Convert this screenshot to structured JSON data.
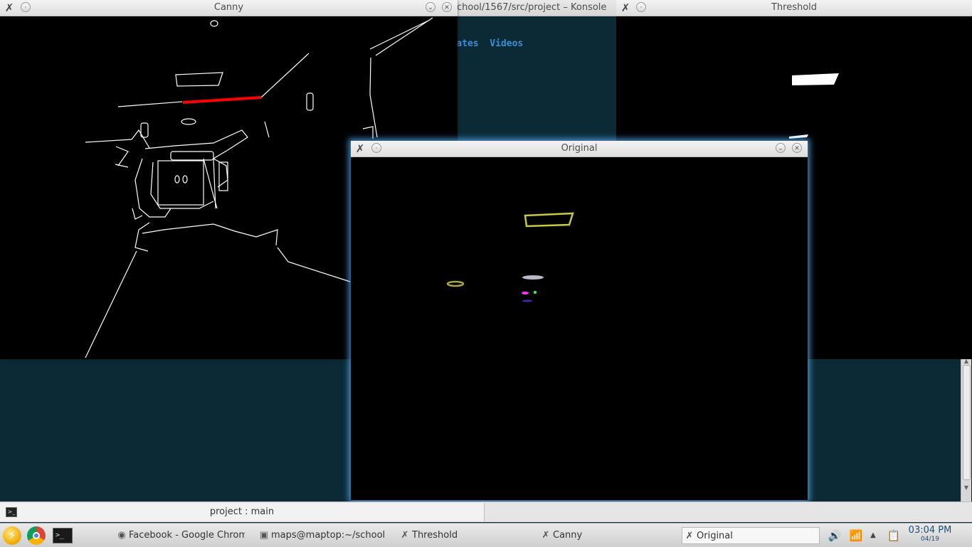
{
  "windows": {
    "konsole": {
      "title": "chool/1567/src/project – Konsole",
      "visible_text": "emplates  Videos"
    },
    "canny": {
      "title": "Canny"
    },
    "threshold": {
      "title": "Threshold"
    },
    "original": {
      "title": "Original"
    }
  },
  "konsole_tab": {
    "label": "project : main"
  },
  "taskbar": {
    "tasks": [
      {
        "label": "Facebook - Google Chrom",
        "icon": "chrome-icon"
      },
      {
        "label": "maps@maptop:~/school",
        "icon": "terminal-icon"
      },
      {
        "label": "Threshold",
        "icon": "x-app-icon"
      },
      {
        "label": "Canny",
        "icon": "x-app-icon"
      },
      {
        "label": "Original",
        "icon": "x-app-icon",
        "active": true
      }
    ],
    "clock": {
      "time": "03:04 PM",
      "date": "04/19"
    }
  },
  "colors": {
    "desktop": "#0b2a36",
    "konsole_link": "#3a8fd6",
    "canny_highlight": "#ff0000",
    "active_glow": "#5ab4ff"
  }
}
